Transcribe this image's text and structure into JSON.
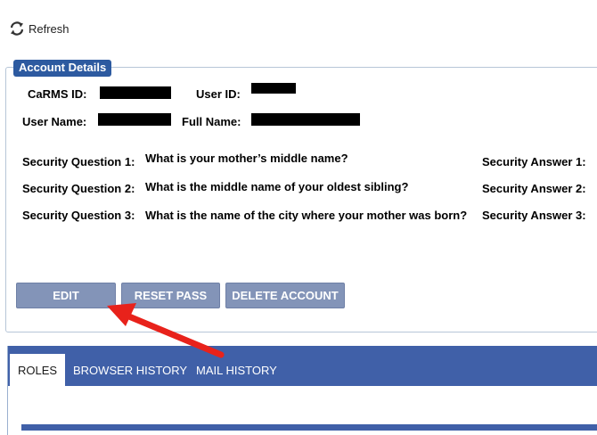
{
  "toolbar": {
    "refresh_label": "Refresh"
  },
  "account_details": {
    "legend": "Account Details",
    "carms_id_label": "CaRMS ID:",
    "user_id_label": "User ID:",
    "user_name_label": "User Name:",
    "full_name_label": "Full Name:",
    "security_questions": [
      {
        "label": "Security Question 1:",
        "question": "What is your mother’s middle name?",
        "answer_label": "Security Answer 1:"
      },
      {
        "label": "Security Question 2:",
        "question": "What is the middle name of your oldest sibling?",
        "answer_label": "Security Answer 2:"
      },
      {
        "label": "Security Question 3:",
        "question": "What is the name of the city where your mother was born?",
        "answer_label": "Security Answer 3:"
      }
    ]
  },
  "buttons": {
    "edit": "EDIT",
    "reset_pass": "RESET PASS",
    "delete_account": "DELETE ACCOUNT"
  },
  "tabs": [
    {
      "label": "ROLES",
      "active": true
    },
    {
      "label": "BROWSER HISTORY",
      "active": false
    },
    {
      "label": "MAIL HISTORY",
      "active": false
    }
  ],
  "colors": {
    "accent": "#2d5aa0",
    "tab_bar": "#4060a8",
    "button": "#8394b8",
    "annotation_arrow": "#e8221b"
  }
}
